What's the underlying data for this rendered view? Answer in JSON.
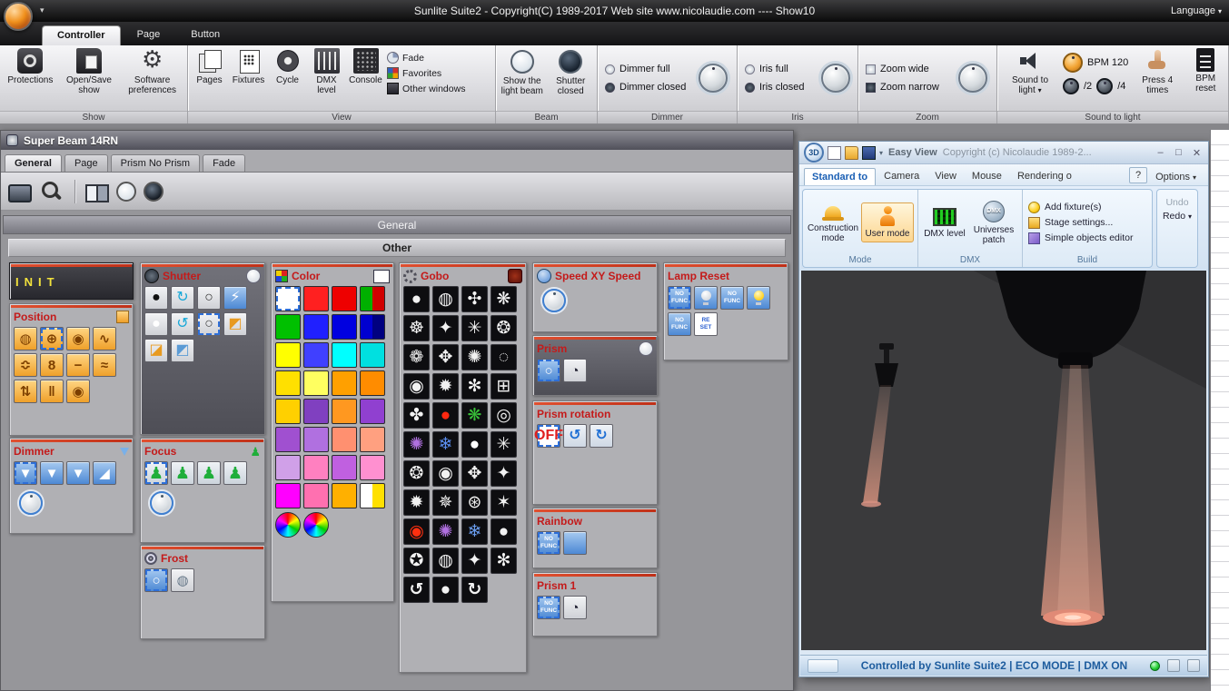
{
  "colors": {
    "panel_accent": "#cc3020",
    "panel_title_red": "#c41a1a",
    "init_yellow": "#f2e23c",
    "status_blue": "#1d5c9e",
    "beam_pink": "#f0a088"
  },
  "titlebar": {
    "title": "Sunlite Suite2 - Copyright(C) 1989-2017    Web site www.nicolaudie.com ---- Show10",
    "language": "Language"
  },
  "ribbon": {
    "tabs": [
      {
        "label": "Controller",
        "cls": "active"
      },
      {
        "label": "Page"
      },
      {
        "label": "Button"
      }
    ],
    "show_group": {
      "label": "Show",
      "buttons": [
        {
          "label": "Protections"
        },
        {
          "label": "Open/Save show"
        },
        {
          "label": "Software preferences"
        }
      ]
    },
    "view_group": {
      "label": "View",
      "big_buttons": [
        {
          "label": "Pages",
          "icon": "ic-pages"
        },
        {
          "label": "Fixtures",
          "icon": "ic-fixtures"
        },
        {
          "label": "Cycle",
          "icon": "ic-cycle"
        },
        {
          "label": "DMX level",
          "icon": "ic-dmxf"
        },
        {
          "label": "Console",
          "icon": "ic-console"
        }
      ],
      "small_buttons": [
        {
          "label": "Fade",
          "icon": "sic-fade"
        },
        {
          "label": "Favorites",
          "icon": "sic-fav"
        },
        {
          "label": "Other windows",
          "icon": "sic-other"
        }
      ]
    },
    "beam_group": {
      "label": "Beam",
      "open_label": "Show the light beam",
      "closed_label": "Shutter closed"
    },
    "dimmer_group": {
      "label": "Dimmer",
      "full": "Dimmer full",
      "closed": "Dimmer closed"
    },
    "iris_group": {
      "label": "Iris",
      "full": "Iris full",
      "closed": "Iris closed"
    },
    "zoom_group": {
      "label": "Zoom",
      "wide": "Zoom wide",
      "narrow": "Zoom narrow"
    },
    "sound_group": {
      "label": "Sound to light",
      "button": "Sound to light",
      "bpm": "BPM 120",
      "div2": "/2",
      "div4": "/4",
      "press": "Press 4 times",
      "reset": "BPM reset"
    }
  },
  "window": {
    "title": "Super Beam 14RN",
    "tabs": [
      {
        "label": "General",
        "cls": "active"
      },
      {
        "label": "Page"
      },
      {
        "label": "Prism No Prism"
      },
      {
        "label": "Fade"
      }
    ],
    "section": "General",
    "group_header": "Other"
  },
  "panels": {
    "init": {
      "title": "INIT"
    },
    "position": {
      "title": "Position",
      "icons": [
        {
          "g": "◍"
        },
        {
          "g": "⊕",
          "cls": "sel"
        },
        {
          "g": "◉"
        },
        {
          "g": "∿"
        },
        {
          "g": "≎"
        },
        {
          "g": "8"
        },
        {
          "g": "−"
        },
        {
          "g": "≈"
        },
        {
          "g": "⇅"
        },
        {
          "g": "‖"
        },
        {
          "g": "◉"
        }
      ]
    },
    "dimmer": {
      "title": "Dimmer",
      "icons": [
        {
          "g": "▼",
          "cls": "sel"
        },
        {
          "g": "▼"
        },
        {
          "g": "▼"
        },
        {
          "g": "◢"
        }
      ]
    },
    "shutter": {
      "title": "Shutter",
      "icons": [
        {
          "g": "●",
          "fg": "#101010"
        },
        {
          "g": "↻",
          "fg": "#18a8d8"
        },
        {
          "g": "○",
          "fg": "#333333"
        },
        {
          "g": "⚡",
          "bg": "linear-gradient(#a6c9f0,#4c88d4)",
          "fg": "#ffffff"
        },
        {
          "g": "●",
          "fg": "#ffffff"
        },
        {
          "g": "↺",
          "fg": "#18a8d8"
        },
        {
          "g": "○",
          "fg": "#444444",
          "cls": "sel"
        },
        {
          "g": "◩",
          "fg": "#e89a20"
        },
        {
          "g": "◪",
          "fg": "#e89a20"
        },
        {
          "g": "◩",
          "fg": "#5b9bd5"
        }
      ]
    },
    "focus": {
      "title": "Focus",
      "icons": [
        {
          "g": "♟",
          "cls": "sel"
        },
        {
          "g": "♟"
        },
        {
          "g": "♟"
        },
        {
          "g": "♟"
        }
      ]
    },
    "frost": {
      "title": "Frost",
      "icons": [
        {
          "g": "○",
          "cls": "sel"
        },
        {
          "g": "◍",
          "bg": "linear-gradient(#f2f3f5,#cfd1d6)",
          "fg": "#667788"
        }
      ]
    },
    "color": {
      "title": "Color",
      "swatches": [
        {
          "bg": "#ffffff",
          "cls": "sel"
        },
        {
          "bg": "#ff2020"
        },
        {
          "bg": "#ee0000"
        },
        {
          "bg": "linear-gradient(90deg,#00b000 50%,#d00000 50%)"
        },
        {
          "bg": "#00c000"
        },
        {
          "bg": "#2020ff"
        },
        {
          "bg": "#0000e0"
        },
        {
          "bg": "linear-gradient(90deg,#0000d0 50%,#000080 50%)"
        },
        {
          "bg": "#ffff00"
        },
        {
          "bg": "#4040ff"
        },
        {
          "bg": "#00ffff"
        },
        {
          "bg": "#00e0e0"
        },
        {
          "bg": "#ffe000"
        },
        {
          "bg": "#ffff60"
        },
        {
          "bg": "#ffa000"
        },
        {
          "bg": "#ff8c00"
        },
        {
          "bg": "#ffd000"
        },
        {
          "bg": "#8040c0"
        },
        {
          "bg": "#ff9820"
        },
        {
          "bg": "#9040d0"
        },
        {
          "bg": "#a050d0"
        },
        {
          "bg": "#b070e0"
        },
        {
          "bg": "#ff9070"
        },
        {
          "bg": "#ffa080"
        },
        {
          "bg": "#d0a0e8"
        },
        {
          "bg": "#ff80c0"
        },
        {
          "bg": "#c060e0"
        },
        {
          "bg": "#ff90d0"
        },
        {
          "bg": "#ff00ff"
        },
        {
          "bg": "#ff70b0"
        },
        {
          "bg": "#ffb000"
        },
        {
          "bg": "linear-gradient(90deg,#ffffff 50%,#ffe000 50%)"
        }
      ],
      "wheels": [
        {
          "cls": "wheel"
        },
        {
          "cls": "wheel"
        }
      ]
    },
    "gobo": {
      "title": "Gobo",
      "icons": [
        {
          "g": "●"
        },
        {
          "g": "◍"
        },
        {
          "g": "✣"
        },
        {
          "g": "❋"
        },
        {
          "g": "☸"
        },
        {
          "g": "✦"
        },
        {
          "g": "✳"
        },
        {
          "g": "❂"
        },
        {
          "g": "❁"
        },
        {
          "g": "✥"
        },
        {
          "g": "✺"
        },
        {
          "g": "◌"
        },
        {
          "g": "◉"
        },
        {
          "g": "✹"
        },
        {
          "g": "✻"
        },
        {
          "g": "⊞"
        },
        {
          "g": "✤"
        },
        {
          "g": "●",
          "fg": "#ff2810"
        },
        {
          "g": "❋",
          "fg": "#38c038"
        },
        {
          "g": "◎"
        },
        {
          "g": "✺",
          "fg": "#b070e0"
        },
        {
          "g": "❄",
          "fg": "#5b8ff2"
        },
        {
          "g": "●",
          "fg": "#ffffff"
        },
        {
          "g": "✳"
        },
        {
          "g": "❂"
        },
        {
          "g": "◉"
        },
        {
          "g": "✥"
        },
        {
          "g": "✦"
        },
        {
          "g": "✹"
        },
        {
          "g": "✵"
        },
        {
          "g": "⊛"
        },
        {
          "g": "✶"
        },
        {
          "g": "◉",
          "fg": "#ff3010"
        },
        {
          "g": "✺",
          "fg": "#b070e0"
        },
        {
          "g": "❄",
          "fg": "#6b9ff2"
        },
        {
          "g": "●"
        },
        {
          "g": "✪"
        },
        {
          "g": "◍"
        },
        {
          "g": "✦"
        },
        {
          "g": "✻"
        },
        {
          "g": "↺",
          "cls": "rot"
        },
        {
          "g": "●"
        },
        {
          "g": "↻",
          "cls": "rot"
        }
      ]
    },
    "speed": {
      "title": "Speed XY Speed"
    },
    "prism": {
      "title": "Prism",
      "icons": [
        {
          "g": "○",
          "cls": "sel"
        },
        {
          "g": "◔",
          "bg": "linear-gradient(#f2f3f5,#cfd1d6)",
          "fg": "#222233"
        }
      ]
    },
    "prism_rotation": {
      "title": "Prism rotation",
      "icons": [
        {
          "g": "OFF",
          "cls": "txt sel",
          "bg": "#ffffff",
          "fg": "#e02020"
        },
        {
          "g": "↺"
        },
        {
          "g": "↻"
        }
      ]
    },
    "rainbow": {
      "title": "Rainbow",
      "icons": [
        {
          "g": "NO FUNC",
          "cls": "txt sel"
        },
        {
          "cls": "rainbow"
        }
      ]
    },
    "prism1": {
      "title": "Prism 1",
      "icons": [
        {
          "g": "NO FUNC",
          "cls": "txt sel"
        },
        {
          "g": "◔",
          "bg": "linear-gradient(#f2f3f5,#cfd1d6)",
          "fg": "#222233"
        }
      ]
    },
    "lamp_reset": {
      "title": "Lamp Reset",
      "icons": [
        {
          "g": "NO FUNC",
          "cls": "txt sel"
        },
        {
          "cls": "bulb"
        },
        {
          "g": "NO FUNC",
          "cls": "txt"
        },
        {
          "cls": "bulb yellow"
        },
        {
          "g": "NO FUNC",
          "cls": "txt"
        },
        {
          "g": "RE SET",
          "cls": "txt",
          "bg": "#ffffff",
          "fg": "#2b5fd0"
        }
      ]
    }
  },
  "easyview": {
    "logo": "3D",
    "title": "Easy View",
    "copyright": "Copyright (c) Nicolaudie 1989-2...",
    "tabs": [
      {
        "label": "Standard to",
        "cls": "active"
      },
      {
        "label": "Camera"
      },
      {
        "label": "View"
      },
      {
        "label": "Mouse"
      },
      {
        "label": "Rendering o"
      }
    ],
    "help": "?",
    "options": "Options",
    "window_buttons": {
      "minimize": "–",
      "maximize": "□",
      "close": "✕"
    },
    "mode_group": {
      "label": "Mode",
      "construction": "Construction mode",
      "user": "User mode"
    },
    "dmx_group": {
      "label": "DMX",
      "level": "DMX level",
      "patch": "Universes patch",
      "patch_icon": "DMX"
    },
    "build_group": {
      "label": "Build",
      "items": [
        {
          "label": "Add fixture(s)",
          "icon": "bi-bulb"
        },
        {
          "label": "Stage settings...",
          "icon": "bi-stage"
        },
        {
          "label": "Simple objects editor",
          "icon": "bi-cube"
        }
      ]
    },
    "undo": "Undo",
    "redo": "Redo",
    "status": "Controlled by Sunlite Suite2   |   ECO MODE   |   DMX ON"
  }
}
